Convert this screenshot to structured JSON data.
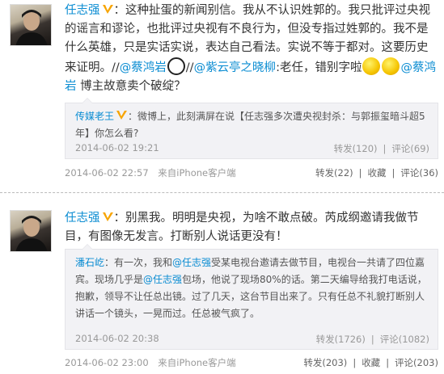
{
  "posts": [
    {
      "author": "任志强",
      "text_main": "：这种扯蛋的新闻别信。我从不认识姓郭的。我只批评过央视的谣言和谬论，也批评过央视有不良行为，但没专指过姓郭的。我不是什么英雄，只是实话实说，表达自己看法。实说不等于都对。这要历史来证明。",
      "text_tail_1": "//",
      "mention_1": "@蔡鸿岩",
      "text_tail_2": "//",
      "mention_2": "@紫云亭之晓柳",
      "text_tail_3": ":老任，错别字啦",
      "mention_3": "@蔡鸿岩",
      "text_tail_4": " 博主故意卖个破绽？",
      "repost": {
        "author": "传媒老王",
        "text": "：微博上，此刻满屏在说【任志强多次遭央视封杀：与郭振玺暗斗超5年】你怎么看?",
        "time": "2014-06-02 19:21",
        "forward": "转发(120)",
        "comment": "评论(69)"
      },
      "time": "2014-06-02 22:57",
      "source": "来自iPhone客户端",
      "forward": "转发(22)",
      "favorite": "收藏",
      "comment": "评论(36)"
    },
    {
      "author": "任志强",
      "text_main": "：别黑我。明明是央视，为啥不敢点破。芮成纲邀请我做节目，有图像无发言。打断别人说话更没有！",
      "repost": {
        "author": "潘石屹",
        "text_a": "：有一次，我和",
        "mention_a": "@任志强",
        "text_b": "受某电视台邀请去做节目，电视台一共请了四位嘉宾。现场几乎是",
        "mention_b": "@任志强",
        "text_c": "包场，他说了现场80%的话。第二天编导给我打电话说，抱歉，领导不让任总出镜。过了几天，这台节目出来了。只有任总不礼貌打断别人讲话一个镜头，一晃而过。任总被气疯了。",
        "time": "2014-06-02 20:38",
        "forward": "转发(1726)",
        "comment": "评论(1082)"
      },
      "time": "2014-06-02 23:00",
      "source": "来自iPhone客户端",
      "forward": "转发(203)",
      "favorite": "收藏",
      "comment": "评论(203)"
    }
  ],
  "colors": {
    "link": "#0a8cd2",
    "repost_bg": "#f2f2f5",
    "meta": "#999999",
    "vbadge": "#f7a400"
  }
}
